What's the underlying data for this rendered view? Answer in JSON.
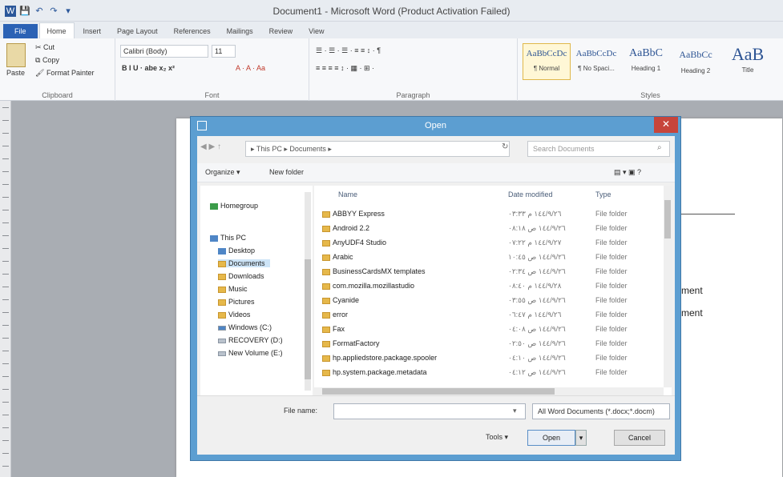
{
  "app": {
    "title": "Document1 - Microsoft Word (Product Activation Failed)",
    "qat": [
      "💾",
      "↶",
      "↷",
      "▾"
    ]
  },
  "tabs": [
    "File",
    "Home",
    "Insert",
    "Page Layout",
    "References",
    "Mailings",
    "Review",
    "View"
  ],
  "ribbon": {
    "clipboard": {
      "cut": "Cut",
      "copy": "Copy",
      "paste": "Paste",
      "format_painter": "Format Painter",
      "label": "Clipboard"
    },
    "font": {
      "font_name": "Calibri (Body)",
      "font_size": "11",
      "format_row": "B  I  U  ·  abe  x₂  x²",
      "color_row": "A  ·  A  ·  Aa",
      "label": "Font"
    },
    "paragraph": {
      "row1": "☰ · ☰ · ☰ ·  ≡ ≡  ↕ ·  ¶",
      "row2": "≡ ≡ ≡ ≡  ↕ ·  ▦ ·  ⊞ ·",
      "label": "Paragraph"
    },
    "styles": {
      "items": [
        {
          "sample": "AaBbCcDc",
          "name": "¶ Normal"
        },
        {
          "sample": "AaBbCcDc",
          "name": "¶ No Spaci..."
        },
        {
          "sample": "AaBbC",
          "name": "Heading 1"
        },
        {
          "sample": "AaBbCc",
          "name": "Heading 2"
        },
        {
          "sample": "AaB",
          "name": "Title"
        }
      ],
      "label": "Styles"
    }
  },
  "page": {
    "text1": "ment",
    "text2": "ment"
  },
  "dialog": {
    "title": "Open",
    "close": "✕",
    "nav": "◀  ▶  ↑",
    "address": "▸ This PC ▸ Documents ▸",
    "refresh": "↻",
    "search_placeholder": "Search Documents",
    "search_icon": "⌕",
    "organize": "Organize ▾",
    "new_folder": "New folder",
    "view_icons": "▤ ▾   ▣   ?",
    "nav_pane": {
      "homegroup": "Homegroup",
      "this_pc": "This PC",
      "items": [
        "Desktop",
        "Documents",
        "Downloads",
        "Music",
        "Pictures",
        "Videos",
        "Windows (C:)",
        "RECOVERY (D:)",
        "New Volume (E:)"
      ]
    },
    "columns": {
      "name": "Name",
      "date": "Date modified",
      "type": "Type"
    },
    "files": [
      {
        "name": "ABBYY Express",
        "date": "١٤٤/٩/٢٦ م ٠٣:٣٣",
        "type": "File folder"
      },
      {
        "name": "Android 2.2",
        "date": "١٤٤/٩/٢٦ ص ٠٨:١٨",
        "type": "File folder"
      },
      {
        "name": "AnyUDF4 Studio",
        "date": "١٤٤/٩/٢٧ م ٠٧:٢٢",
        "type": "File folder"
      },
      {
        "name": "Arabic",
        "date": "١٤٤/٩/٢٦ ص ١٠:٤٥",
        "type": "File folder"
      },
      {
        "name": "BusinessCardsMX templates",
        "date": "١٤٤/٩/٢٦ ص ٠٢:٣٤",
        "type": "File folder"
      },
      {
        "name": "com.mozilla.mozillastudio",
        "date": "١٤٤/٩/٢٨ م ٠٨:٤٠",
        "type": "File folder"
      },
      {
        "name": "Cyanide",
        "date": "١٤٤/٩/٢٦ ص ٠٣:٥٥",
        "type": "File folder"
      },
      {
        "name": "error",
        "date": "١٤٤/٩/٢٦ م ٠٦:٤٧",
        "type": "File folder"
      },
      {
        "name": "Fax",
        "date": "١٤٤/٩/٢٦ ص ٠٤:٠٨",
        "type": "File folder"
      },
      {
        "name": "FormatFactory",
        "date": "١٤٤/٩/٢٦ ص ٠٢:٥٠",
        "type": "File folder"
      },
      {
        "name": "hp.appliedstore.package.spooler",
        "date": "١٤٤/٩/٢٦ ص ٠٤:١٠",
        "type": "File folder"
      },
      {
        "name": "hp.system.package.metadata",
        "date": "١٤٤/٩/٢٦ ص ٠٤:١٢",
        "type": "File folder"
      }
    ],
    "filename_label": "File name:",
    "filename_value": "",
    "filetype": "All Word Documents (*.docx;*.docm)",
    "tools": "Tools  ▾",
    "open": "Open",
    "open_drop": "▾",
    "cancel": "Cancel"
  }
}
